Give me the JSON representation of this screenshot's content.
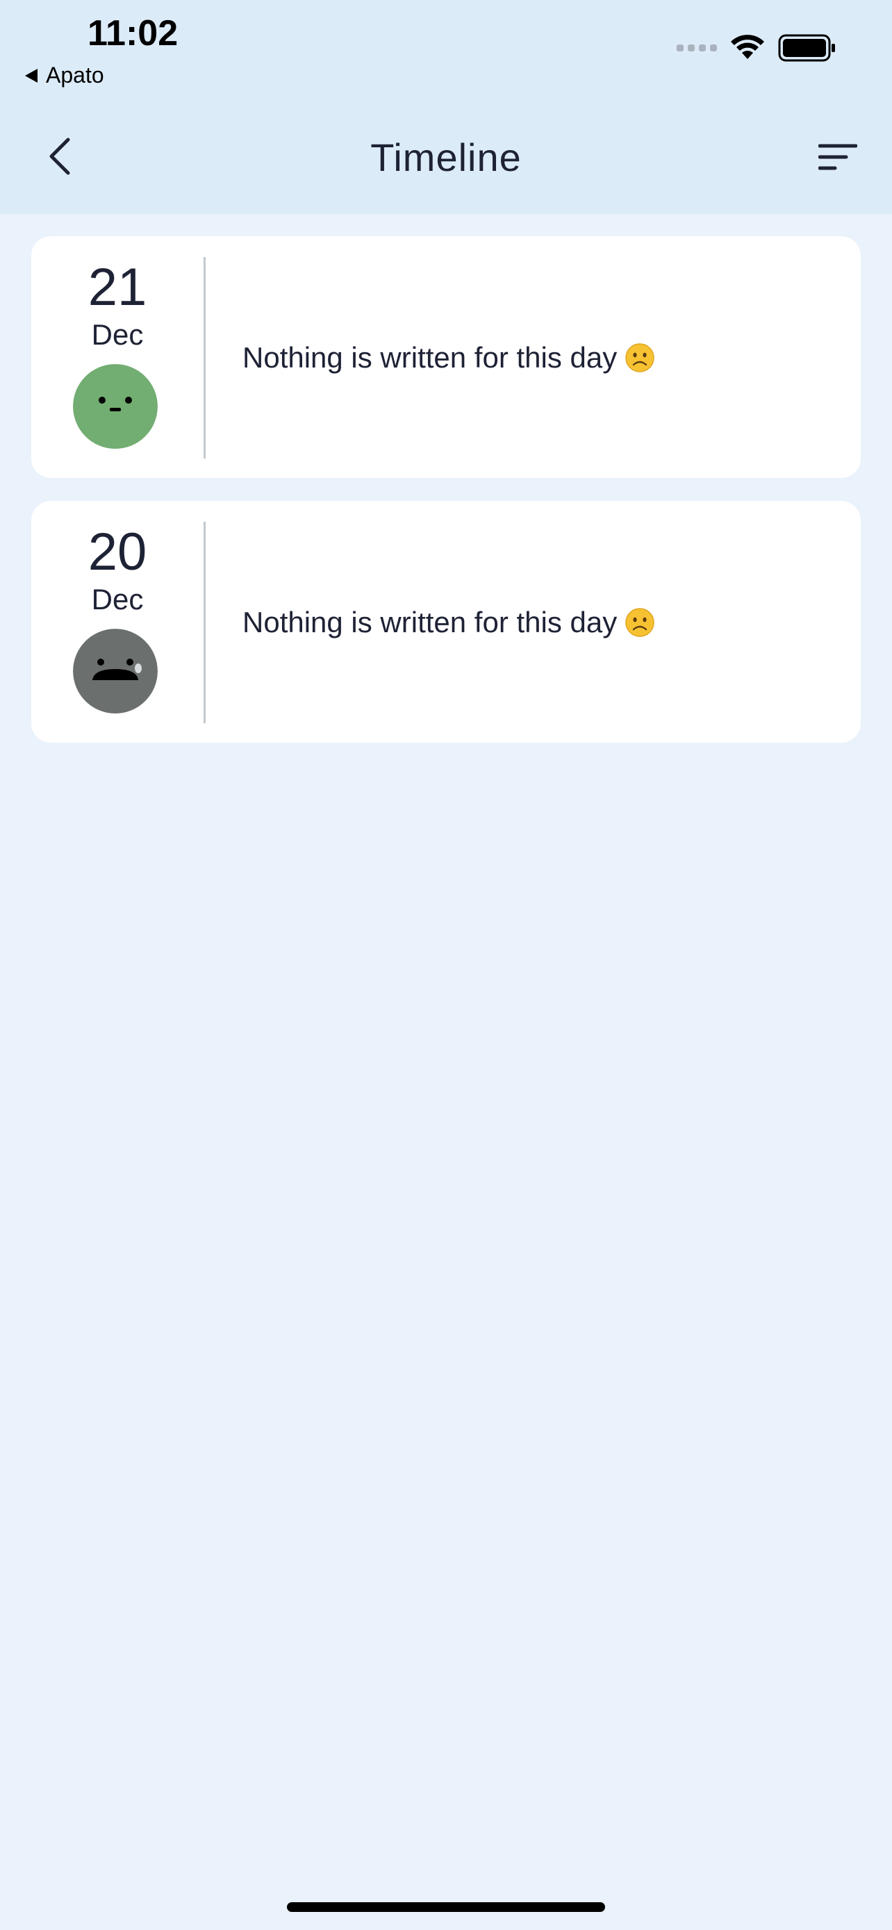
{
  "status_bar": {
    "time": "11:02",
    "back_app_label": "Apato"
  },
  "nav": {
    "title": "Timeline",
    "back_icon": "chevron-left-icon",
    "sort_icon": "sort-lines-icon"
  },
  "entries": [
    {
      "day": "21",
      "month": "Dec",
      "mood": "neutral",
      "mood_color": "#72ad71",
      "text": "Nothing is written for this day"
    },
    {
      "day": "20",
      "month": "Dec",
      "mood": "crying",
      "mood_color": "#6b706e",
      "text": "Nothing is written for this day"
    }
  ],
  "colors": {
    "header_bg": "#dcebf8",
    "page_bg": "#eaf2fb",
    "card_bg": "#ffffff",
    "text": "#1e2235"
  }
}
